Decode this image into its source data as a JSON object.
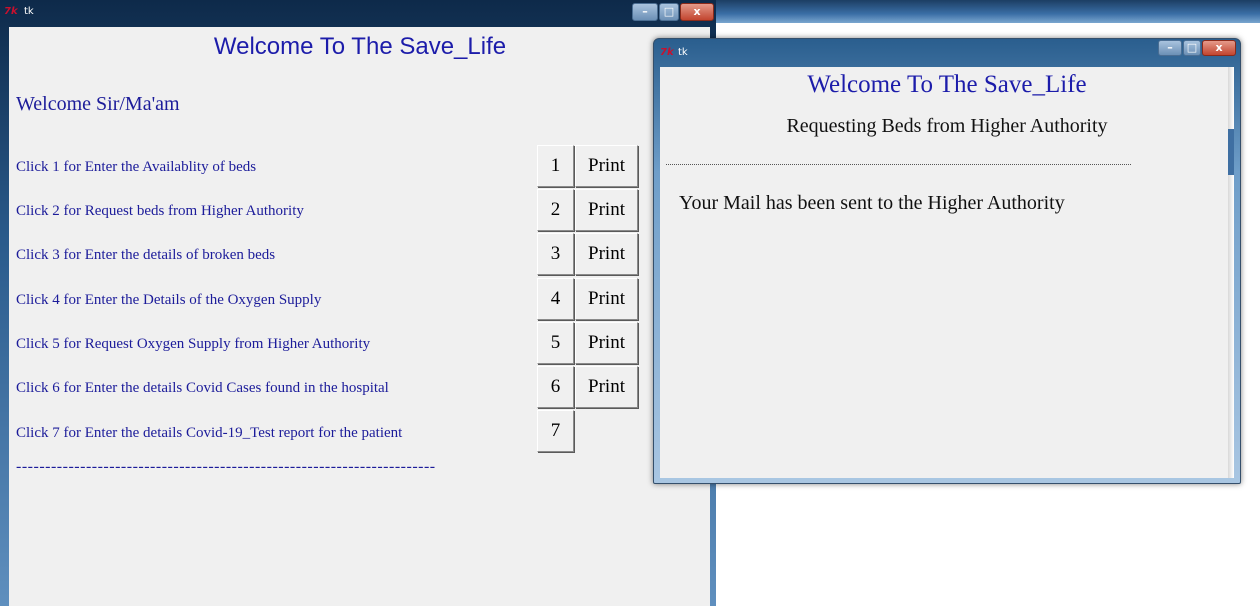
{
  "main_window": {
    "title_icon": "tk-logo",
    "title_text": "tk",
    "controls": {
      "minimize": "–",
      "maximize": "□",
      "close": "x"
    },
    "heading": "Welcome To The Save_Life",
    "greeting": "Welcome Sir/Ma'am",
    "options": [
      {
        "label": "Click 1 for Enter the Availablity of beds",
        "number": "1",
        "print": "Print"
      },
      {
        "label": "Click 2 for Request beds from Higher Authority",
        "number": "2",
        "print": "Print"
      },
      {
        "label": "Click 3 for Enter the details of broken beds",
        "number": "3",
        "print": "Print"
      },
      {
        "label": "Click 4 for Enter the Details of the Oxygen Supply",
        "number": "4",
        "print": "Print"
      },
      {
        "label": "Click 5 for Request Oxygen Supply from Higher Authority",
        "number": "5",
        "print": "Print"
      },
      {
        "label": "Click 6 for Enter the details Covid Cases found in the hospital",
        "number": "6",
        "print": "Print"
      },
      {
        "label": "Click 7 for Enter the details Covid-19_Test report for the patient",
        "number": "7"
      }
    ],
    "separator": "------------------------------------------------------------------------"
  },
  "popup_window": {
    "title_icon": "tk-logo",
    "title_text": "tk",
    "controls": {
      "minimize": "–",
      "maximize": "□",
      "close": "x"
    },
    "heading": "Welcome To The Save_Life",
    "subheading": "Requesting  Beds from Higher Authority",
    "message": "Your Mail has been sent to the Higher Authority"
  },
  "colors": {
    "heading_blue": "#1c1caa",
    "client_bg": "#f0f0f0",
    "titlebar_blue": "#2a5b8c"
  }
}
